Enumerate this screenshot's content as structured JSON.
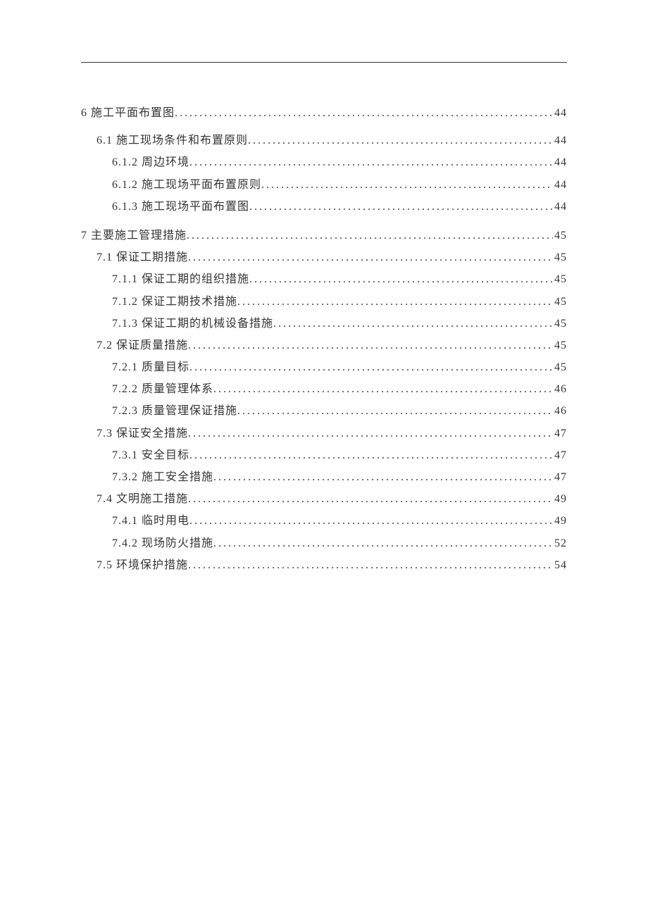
{
  "toc": [
    {
      "level": 1,
      "title": "6 施工平面布置图",
      "page": "44"
    },
    {
      "level": 2,
      "title": "6.1 施工现场条件和布置原则",
      "page": "44"
    },
    {
      "level": 3,
      "title": "6.1.2 周边环境",
      "page": "44"
    },
    {
      "level": 3,
      "title": "6.1.2 施工现场平面布置原则",
      "page": "44"
    },
    {
      "level": 3,
      "title": "6.1.3 施工现场平面布置图",
      "page": "44"
    },
    {
      "level": 1,
      "title": "7 主要施工管理措施",
      "page": "45"
    },
    {
      "level": 2,
      "title": "7.1 保证工期措施",
      "page": "45"
    },
    {
      "level": 3,
      "title": "7.1.1 保证工期的组织措施",
      "page": "45"
    },
    {
      "level": 3,
      "title": "7.1.2 保证工期技术措施",
      "page": "45"
    },
    {
      "level": 3,
      "title": "7.1.3 保证工期的机械设备措施",
      "page": "45"
    },
    {
      "level": 2,
      "title": "7.2 保证质量措施",
      "page": "45"
    },
    {
      "level": 3,
      "title": "7.2.1 质量目标",
      "page": "45"
    },
    {
      "level": 3,
      "title": "7.2.2 质量管理体系",
      "page": "46"
    },
    {
      "level": 3,
      "title": "7.2.3 质量管理保证措施",
      "page": "46"
    },
    {
      "level": 2,
      "title": "7.3 保证安全措施",
      "page": "47"
    },
    {
      "level": 3,
      "title": "7.3.1 安全目标",
      "page": "47"
    },
    {
      "level": 3,
      "title": "7.3.2 施工安全措施",
      "page": "47"
    },
    {
      "level": 2,
      "title": "7.4 文明施工措施",
      "page": "49"
    },
    {
      "level": 3,
      "title": "7.4.1 临时用电",
      "page": "49"
    },
    {
      "level": 3,
      "title": "7.4.2 现场防火措施",
      "page": "52"
    },
    {
      "level": 2,
      "title": "7.5 环境保护措施",
      "page": "54"
    }
  ]
}
